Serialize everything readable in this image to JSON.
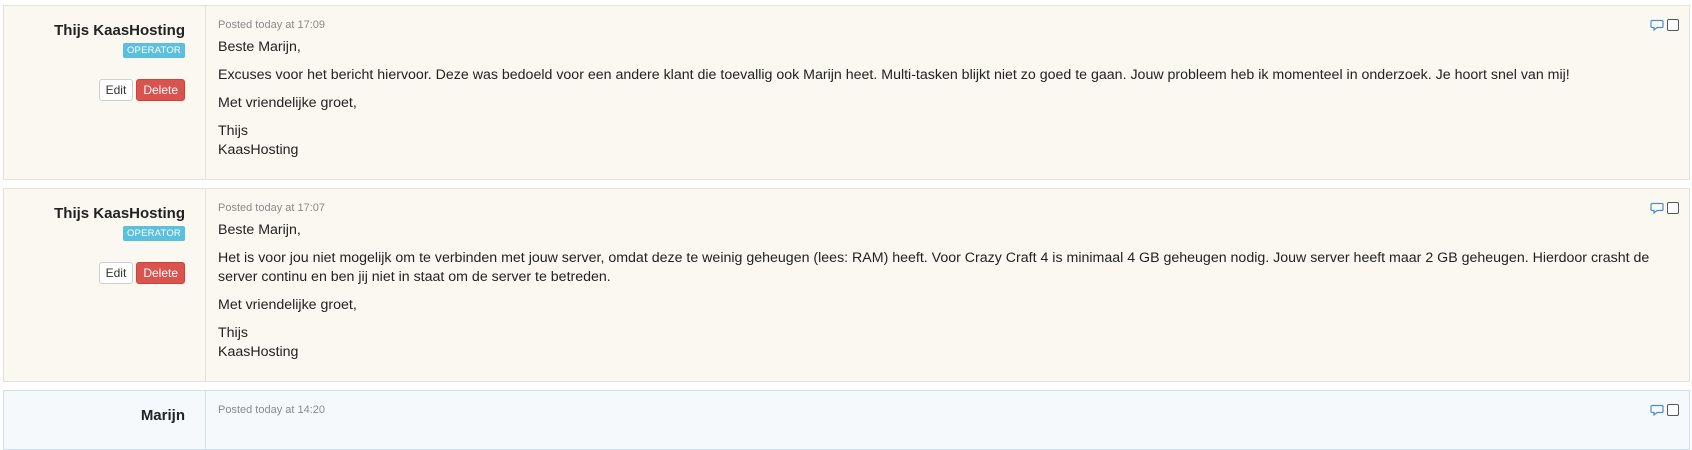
{
  "replies": [
    {
      "author": "Thijs KaasHosting",
      "badge": "OPERATOR",
      "edit_label": "Edit",
      "delete_label": "Delete",
      "posted": "Posted today at 17:09",
      "paragraphs": [
        "Beste Marijn,",
        "Excuses voor het bericht hiervoor. Deze was bedoeld voor een andere klant die toevallig ook Marijn heet. Multi-tasken blijkt niet zo goed te gaan. Jouw probleem heb ik momenteel in onderzoek. Je hoort snel van mij!",
        "Met vriendelijke groet,",
        "Thijs",
        "KaasHosting"
      ]
    },
    {
      "author": "Thijs KaasHosting",
      "badge": "OPERATOR",
      "edit_label": "Edit",
      "delete_label": "Delete",
      "posted": "Posted today at 17:07",
      "paragraphs": [
        "Beste Marijn,",
        "Het is voor jou niet mogelijk om te verbinden met jouw server, omdat deze te weinig geheugen (lees: RAM) heeft. Voor Crazy Craft 4 is minimaal 4 GB geheugen nodig. Jouw server heeft maar 2 GB geheugen. Hierdoor crasht de server continu en ben jij niet in staat om de server te betreden.",
        "Met vriendelijke groet,",
        "Thijs",
        "KaasHosting"
      ]
    },
    {
      "author": "Marijn",
      "posted": "Posted today at 14:20"
    }
  ],
  "colors": {
    "operator_badge": "#5bc0de",
    "delete_button": "#d9534f",
    "operator_bg": "#fbf8f1",
    "client_bg": "#f5f9fc"
  },
  "icons": {
    "quote": "speech-bubble-icon",
    "select": "checkbox-icon"
  }
}
